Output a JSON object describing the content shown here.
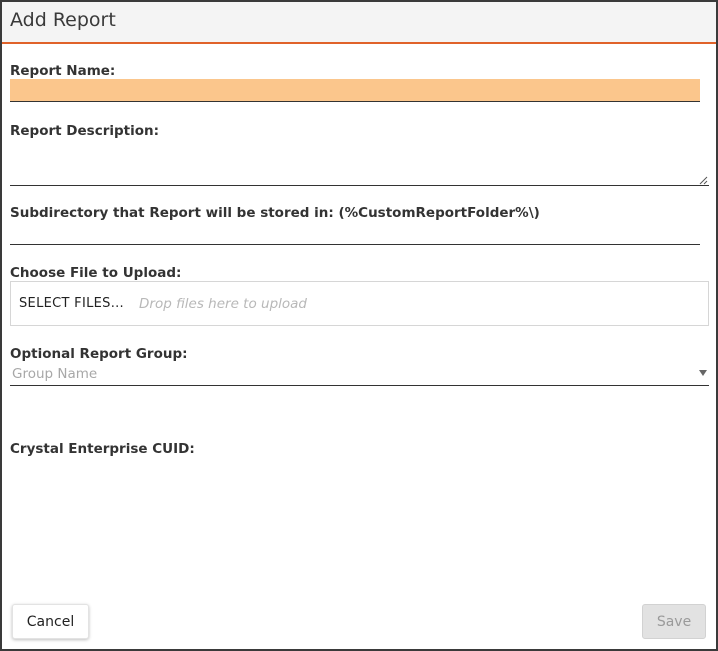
{
  "dialog": {
    "title": "Add Report"
  },
  "form": {
    "report_name": {
      "label": "Report Name:",
      "value": ""
    },
    "report_description": {
      "label": "Report Description:",
      "value": ""
    },
    "subdirectory": {
      "label": "Subdirectory that Report will be stored in: (%CustomReportFolder%\\)",
      "value": ""
    },
    "file_upload": {
      "label": "Choose File to Upload:",
      "button_label": "SELECT FILES...",
      "drop_hint": "Drop files here to upload"
    },
    "report_group": {
      "label": "Optional Report Group:",
      "placeholder": "Group Name"
    },
    "crystal_cuid": {
      "label": "Crystal Enterprise CUID:"
    }
  },
  "footer": {
    "cancel_label": "Cancel",
    "save_label": "Save"
  },
  "colors": {
    "accent": "#e0622a",
    "focused_field": "#fbc68c",
    "disabled_button": "#e2e2e2"
  }
}
